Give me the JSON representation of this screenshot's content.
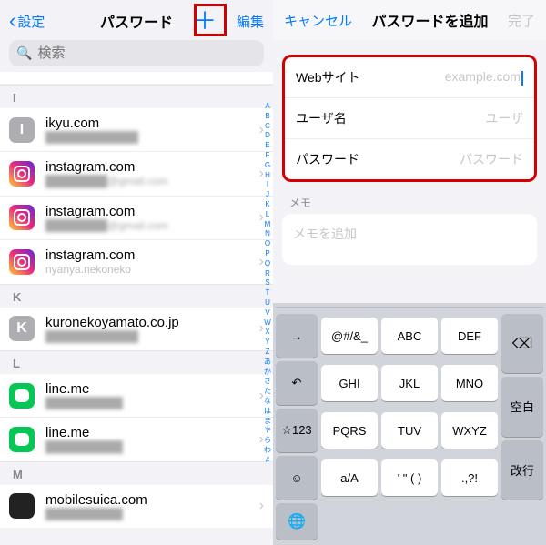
{
  "left": {
    "back": "設定",
    "title": "パスワード",
    "edit": "編集",
    "search_placeholder": "検索",
    "sections": [
      {
        "letter": "I",
        "rows": [
          {
            "site": "ikyu.com",
            "iconType": "gray",
            "iconLetter": "I",
            "sub": "████████████"
          },
          {
            "site": "instagram.com",
            "iconType": "ig",
            "sub": "████████@gmail.com"
          },
          {
            "site": "instagram.com",
            "iconType": "ig",
            "sub": "████████@gmail.com"
          },
          {
            "site": "instagram.com",
            "iconType": "ig",
            "sub": "nyanya.nekoneko"
          }
        ]
      },
      {
        "letter": "K",
        "rows": [
          {
            "site": "kuronekoyamato.co.jp",
            "iconType": "gray",
            "iconLetter": "K",
            "sub": "████████████"
          }
        ]
      },
      {
        "letter": "L",
        "rows": [
          {
            "site": "line.me",
            "iconType": "line",
            "sub": "██████████"
          },
          {
            "site": "line.me",
            "iconType": "line",
            "sub": "██████████"
          }
        ]
      },
      {
        "letter": "M",
        "rows": [
          {
            "site": "mobilesuica.com",
            "iconType": "suica",
            "sub": "██████████"
          }
        ]
      }
    ],
    "index": [
      "A",
      "B",
      "C",
      "D",
      "E",
      "F",
      "G",
      "H",
      "I",
      "J",
      "K",
      "L",
      "M",
      "N",
      "O",
      "P",
      "Q",
      "R",
      "S",
      "T",
      "U",
      "V",
      "W",
      "X",
      "Y",
      "Z",
      "あ",
      "か",
      "さ",
      "た",
      "な",
      "は",
      "ま",
      "や",
      "ら",
      "わ",
      "#"
    ]
  },
  "right": {
    "cancel": "キャンセル",
    "title": "パスワードを追加",
    "done": "完了",
    "fields": {
      "website_label": "Webサイト",
      "website_placeholder": "example.com",
      "username_label": "ユーザ名",
      "username_placeholder": "ユーザ",
      "password_label": "パスワード",
      "password_placeholder": "パスワード"
    },
    "notes_label": "メモ",
    "notes_placeholder": "メモを追加",
    "keyboard": {
      "row1": [
        "@#/&_",
        "ABC",
        "DEF"
      ],
      "row2": [
        "GHI",
        "JKL",
        "MNO"
      ],
      "row3": [
        "PQRS",
        "TUV",
        "WXYZ"
      ],
      "row4": [
        "a/A",
        "' \" ( )",
        ".,?!"
      ],
      "arrow": "→",
      "undo": "↶",
      "star123": "☆123",
      "emoji": "☺",
      "space": "空白",
      "enter": "改行"
    }
  }
}
